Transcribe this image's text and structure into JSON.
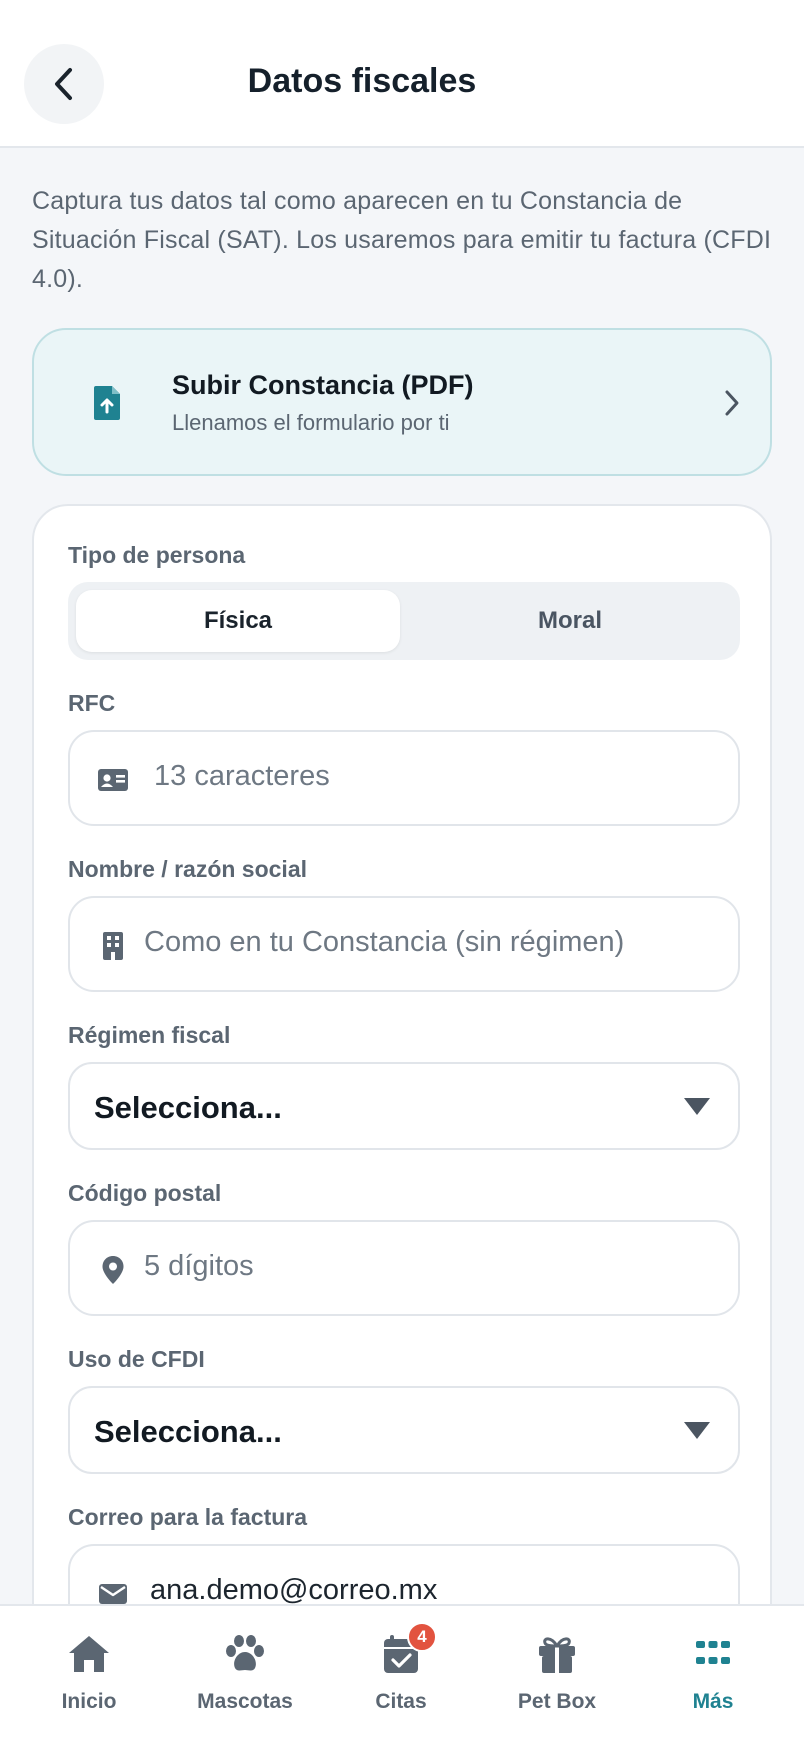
{
  "header": {
    "title": "Datos fiscales"
  },
  "intro": {
    "text": "Captura tus datos tal como aparecen en tu Constancia de Situación Fiscal (SAT). Los usaremos para emitir tu factura (CFDI 4.0)."
  },
  "upload": {
    "title": "Subir Constancia (PDF)",
    "subtitle": "Llenamos el formulario por ti",
    "icon": "file-upload-icon"
  },
  "form": {
    "persona": {
      "label": "Tipo de persona",
      "options": [
        "Física",
        "Moral"
      ],
      "selected": "Física"
    },
    "rfc": {
      "label": "RFC",
      "placeholder": "13 caracteres",
      "icon": "id-card-icon"
    },
    "nombre": {
      "label": "Nombre / razón social",
      "placeholder": "Como en tu Constancia (sin régimen)",
      "icon": "building-icon"
    },
    "regimen": {
      "label": "Régimen fiscal",
      "value": "Selecciona..."
    },
    "cp": {
      "label": "Código postal",
      "placeholder": "5 dígitos",
      "icon": "location-pin-icon"
    },
    "uso": {
      "label": "Uso de CFDI",
      "value": "Selecciona..."
    },
    "correo": {
      "label": "Correo para la factura",
      "value": "ana.demo@correo.mx",
      "icon": "envelope-icon"
    }
  },
  "nav": {
    "items": [
      {
        "label": "Inicio",
        "icon": "home-icon"
      },
      {
        "label": "Mascotas",
        "icon": "paw-icon"
      },
      {
        "label": "Citas",
        "icon": "calendar-check-icon",
        "badge": "4"
      },
      {
        "label": "Pet Box",
        "icon": "gift-icon"
      },
      {
        "label": "Más",
        "icon": "grid-icon",
        "active": true
      }
    ]
  },
  "colors": {
    "accent": "#1f8291",
    "badge": "#e2533f",
    "background": "#f4f6f9"
  }
}
